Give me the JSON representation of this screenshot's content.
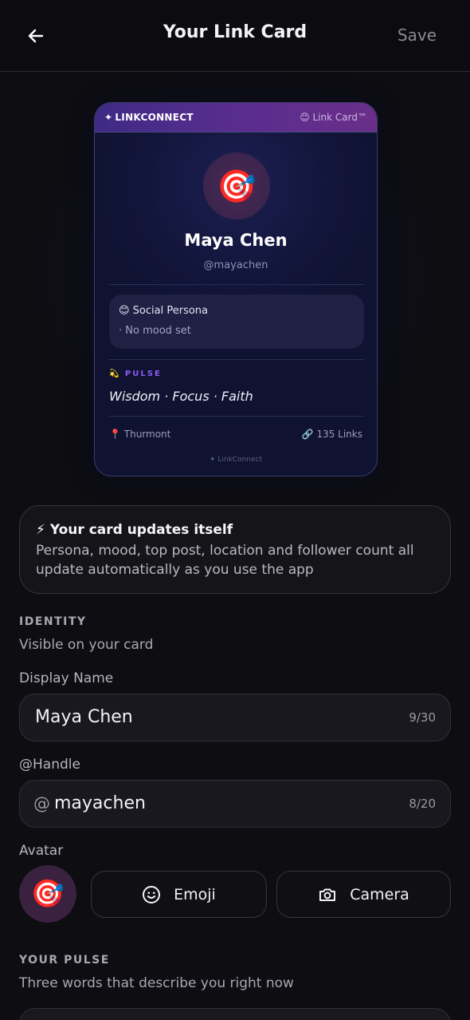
{
  "header": {
    "title": "Your Link Card",
    "save_label": "Save",
    "back_icon": "arrow-left-icon"
  },
  "card": {
    "brand": "LINKCONNECT",
    "brand_icon": "sparkle-icon",
    "tag": "😊 Link Card™",
    "avatar_emoji": "🎯",
    "name": "Maya Chen",
    "handle": "@mayachen",
    "persona_title": "😊 Social Persona",
    "persona_mood": "· No mood set",
    "pulse_label": "💫 PULSE",
    "pulse_words": "Wisdom · Focus · Faith",
    "location": "📍 Thurmont",
    "links": "🔗 135 Links",
    "footer": "✦ LinkConnect",
    "colors": {
      "accent": "#8b5cf6",
      "card_bg": "#12153a",
      "topbar": "#5b2d8e"
    }
  },
  "info": {
    "title": "⚡ Your card updates itself",
    "text": "Persona, mood, top post, location and follower count all update automatically as you use the app"
  },
  "identity": {
    "section_label": "IDENTITY",
    "section_sub": "Visible on your card",
    "display_name_label": "Display Name",
    "display_name_value": "Maya Chen",
    "display_name_count": "9/30",
    "handle_label": "@Handle",
    "handle_prefix": "@",
    "handle_value": "mayachen",
    "handle_count": "8/20",
    "avatar_label": "Avatar",
    "avatar_emoji": "🎯",
    "emoji_button": "Emoji",
    "emoji_icon": "smiley-icon",
    "camera_button": "Camera",
    "camera_icon": "camera-icon"
  },
  "pulse": {
    "section_label": "YOUR PULSE",
    "section_sub": "Three words that describe you right now"
  }
}
